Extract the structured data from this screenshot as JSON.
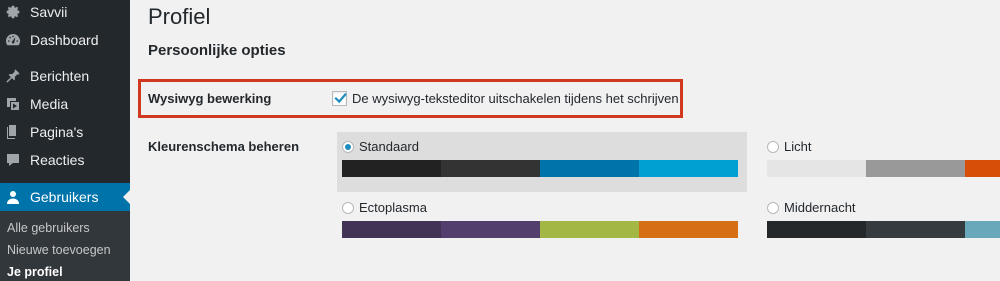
{
  "sidebar": {
    "items": [
      {
        "label": "Savvii",
        "icon": "gear-icon"
      },
      {
        "label": "Dashboard",
        "icon": "dashboard-icon"
      },
      {
        "label": "Berichten",
        "icon": "pin-icon"
      },
      {
        "label": "Media",
        "icon": "media-icon"
      },
      {
        "label": "Pagina's",
        "icon": "pages-icon"
      },
      {
        "label": "Reacties",
        "icon": "comments-icon"
      },
      {
        "label": "Gebruikers",
        "icon": "users-icon"
      }
    ],
    "submenu": [
      "Alle gebruikers",
      "Nieuwe toevoegen",
      "Je profiel"
    ]
  },
  "page": {
    "title": "Profiel",
    "section_title": "Persoonlijke opties"
  },
  "wysiwyg": {
    "label": "Wysiwyg bewerking",
    "checkbox_label": "De wysiwyg-teksteditor uitschakelen tijdens het schrijven",
    "checked": true
  },
  "color_scheme": {
    "label": "Kleurenschema beheren",
    "schemes": [
      {
        "name": "Standaard",
        "selected": true,
        "colors": [
          "#222222",
          "#333333",
          "#0073aa",
          "#00a0d2"
        ]
      },
      {
        "name": "Licht",
        "selected": false,
        "colors": [
          "#e5e5e5",
          "#999999",
          "#d64e07",
          "#04a4cc"
        ]
      },
      {
        "name": "Ectoplasma",
        "selected": false,
        "colors": [
          "#413256",
          "#523f6d",
          "#a3b745",
          "#d46f15"
        ]
      },
      {
        "name": "Middernacht",
        "selected": false,
        "colors": [
          "#25282b",
          "#363b3f",
          "#69a8bb",
          "#e14d43"
        ]
      }
    ]
  },
  "colors": {
    "sidebar_bg": "#23282d",
    "accent": "#0073aa",
    "highlight_border": "#d0381f",
    "checkmark": "#1e8cbe"
  }
}
